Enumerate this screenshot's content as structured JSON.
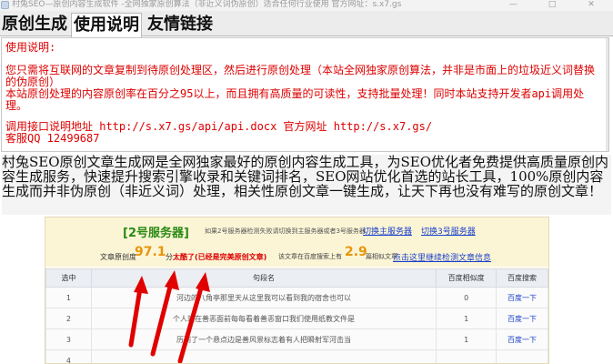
{
  "window": {
    "title": "村兔SEO—原创内容生成软件 -全网独家原创算法（非近义词伪原创）适合任何行业使用 官方网址：s.x7.gs",
    "minimize": "—",
    "maximize": "□",
    "close": "✕"
  },
  "tabs": [
    {
      "label": "原创生成",
      "active": false
    },
    {
      "label": "使用说明",
      "active": true
    },
    {
      "label": "友情链接",
      "active": false
    }
  ],
  "usage": {
    "heading": "使用说明:",
    "line1": "您只需将互联网的文章复制到待原创处理区，然后进行原创处理（本站全网独家原创算法，并非是市面上的垃圾近义词替换的伪原创）",
    "line2": "本站原创处理的内容原创率在百分之95以上，而且拥有高质量的可读性，支持批量处理！同时本站支持开发者api调用处理。",
    "api_line": "调用接口说明地址 http://s.x7.gs/api/api.docx    官方网址 http://s.x7.gs/",
    "qq": "客服QQ 12499687"
  },
  "intro": "村兔SEO原创文章生成网是全网独家最好的原创内容生成工具，为SEO优化者免费提供高质量原创内容生成服务，快速提升搜索引擎收录和关键词排名，SEO网站优化首选的站长工具，100%原创内容生成而并非伪原创（非近义词）处理，相关性原创文章一键生成，让天下再也没有难写的原创文章！",
  "embedded": {
    "server_title": "[2号服务器]",
    "server_desc": "如果2号服务器检测失败请切换到主服务器或者3号服务器",
    "switch_main": "切换主服务器",
    "switch_3": "切换3号服务器",
    "rate_label": "文章原创度",
    "rate_value": "97.1",
    "rate_unit": "分",
    "rate_tag": "太酷了(已经是完美原创文章)",
    "baidu_text": "该文章在百度搜索上有",
    "baidu_value": "2.9",
    "baidu_unit": "篇相似文章",
    "check_link": "点击这里继续检测文章信息",
    "columns": [
      "选中",
      "句段名",
      "百度相似度",
      "百度搜索"
    ],
    "rows": [
      {
        "sel": "1",
        "sentence": "河边的八角亭那里天从这里我可以看到我的宿舍也可以",
        "sim": "0",
        "action": "百度一下"
      },
      {
        "sel": "2",
        "sentence": "个人站在善恶面前每每看着善恶窗口我们使用纸教文件是",
        "sim": "1",
        "action": "百度一下"
      },
      {
        "sel": "3",
        "sentence": "历到了一个悬点边是善风景标志着有人把瞬射军河击当",
        "sim": "1",
        "action": "百度一下"
      },
      {
        "sel": "4",
        "sentence": "",
        "sim": "",
        "action": ""
      }
    ]
  },
  "colors": {
    "usage_text": "#dd0000",
    "server_green": "#2a8a12",
    "value_orange": "#e8950a",
    "link_blue": "#1a3fc8",
    "arrow_red": "#e00000"
  }
}
